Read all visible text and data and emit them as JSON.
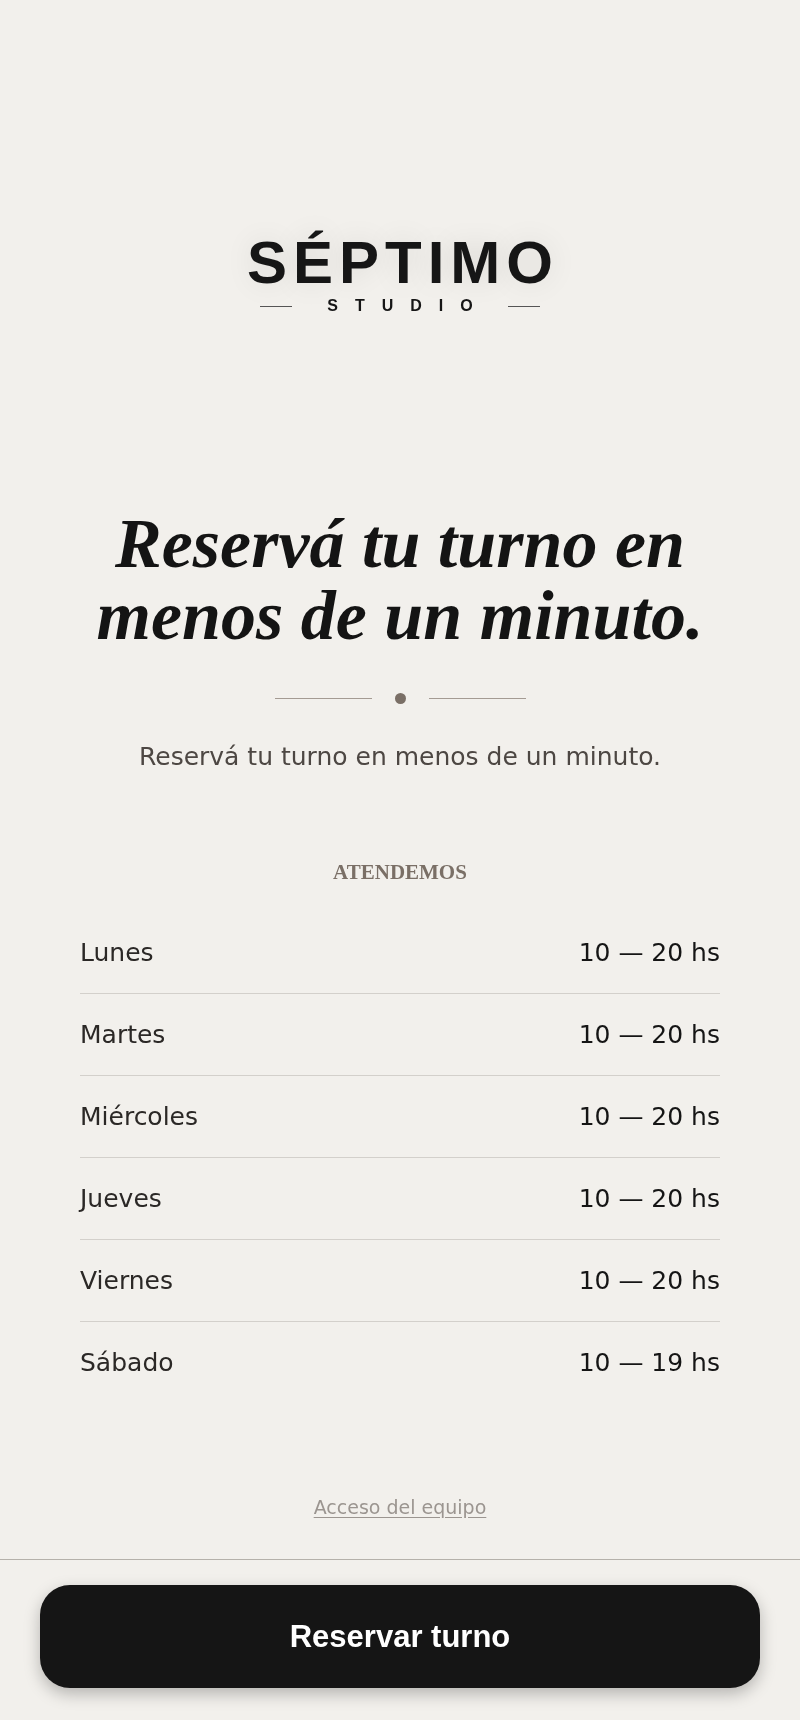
{
  "logo": {
    "name": "SÉPTIMO",
    "tagline": "STUDIO"
  },
  "headline": "Reservá tu turno en menos de un minuto.",
  "subtitle": "Reservá tu turno en menos de un minuto.",
  "hours": {
    "title": "ATENDEMOS",
    "rows": [
      {
        "day": "Lunes",
        "time": "10 — 20 hs"
      },
      {
        "day": "Martes",
        "time": "10 — 20 hs"
      },
      {
        "day": "Miércoles",
        "time": "10 — 20 hs"
      },
      {
        "day": "Jueves",
        "time": "10 — 20 hs"
      },
      {
        "day": "Viernes",
        "time": "10 — 20 hs"
      },
      {
        "day": "Sábado",
        "time": "10 — 19 hs"
      }
    ]
  },
  "team_link": "Acceso del equipo",
  "book_button": "Reservar turno"
}
